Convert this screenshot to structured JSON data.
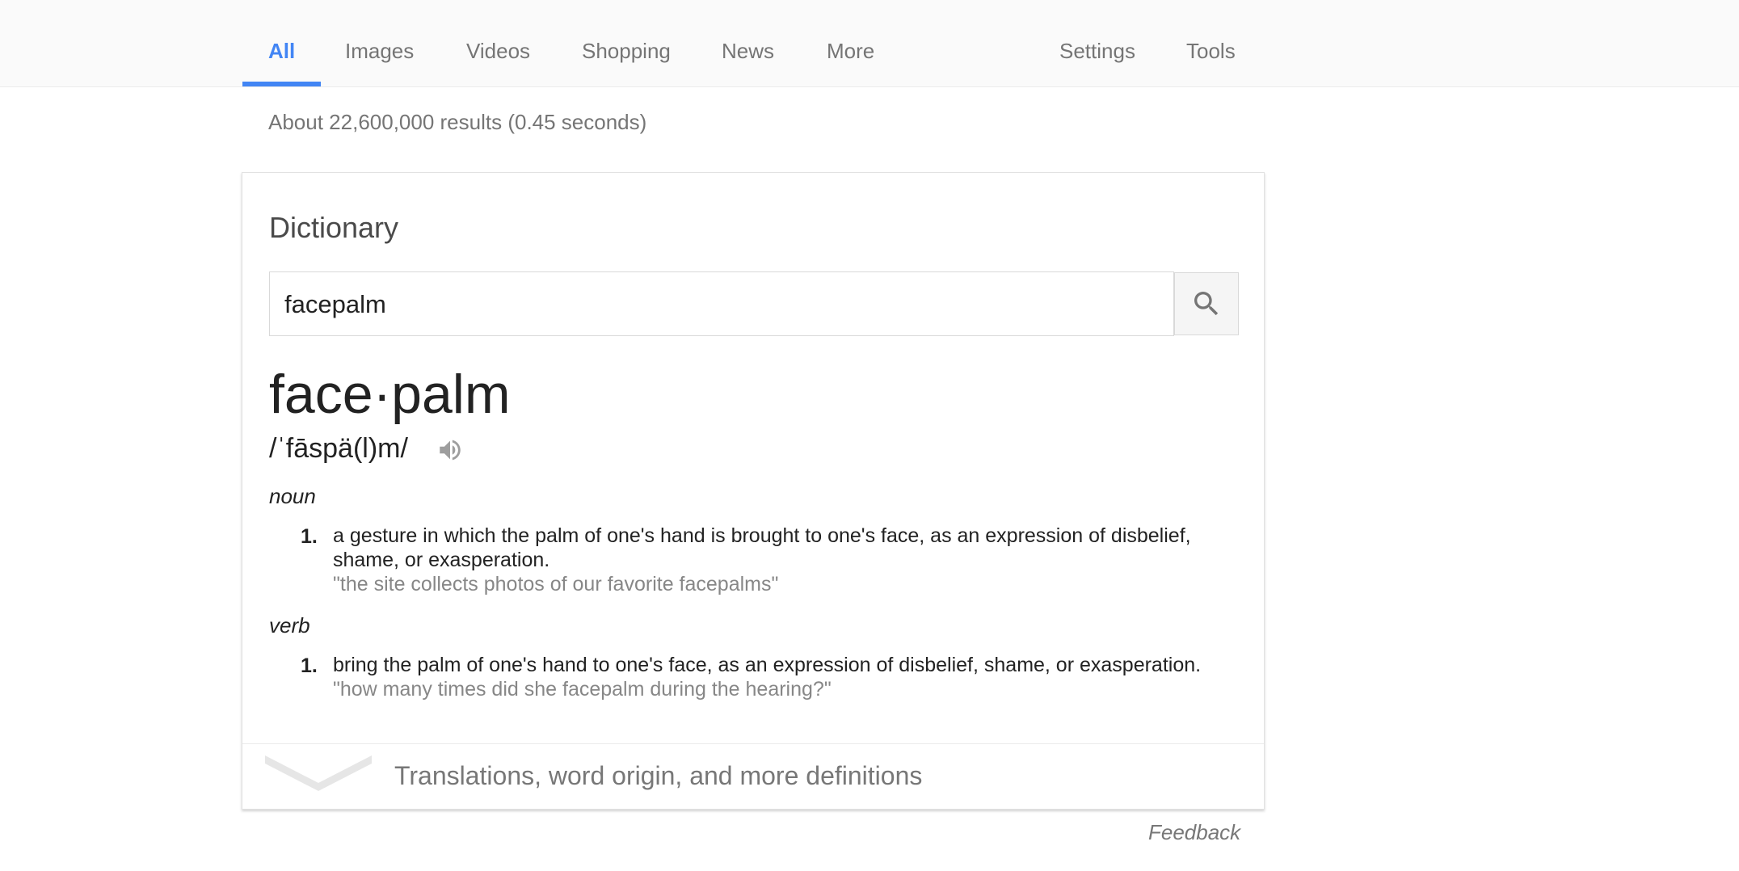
{
  "nav": {
    "tabs": [
      {
        "label": "All",
        "active": true
      },
      {
        "label": "Images"
      },
      {
        "label": "Videos"
      },
      {
        "label": "Shopping"
      },
      {
        "label": "News"
      },
      {
        "label": "More"
      }
    ],
    "settings_label": "Settings",
    "tools_label": "Tools",
    "accent_color": "#4285f4"
  },
  "results_stats": "About 22,600,000 results (0.45 seconds)",
  "dictionary": {
    "title": "Dictionary",
    "search": {
      "value": "facepalm",
      "button_icon": "search-icon"
    },
    "headword": "face·palm",
    "phonetic": "/ˈfāspä(l)m/",
    "speaker_icon": "speaker-icon",
    "entries": [
      {
        "pos": "noun",
        "definitions": [
          {
            "number": "1.",
            "text": "a gesture in which the palm of one's hand is brought to one's face, as an expression of disbelief, shame, or exasperation.",
            "example": "\"the site collects photos of our favorite facepalms\""
          }
        ]
      },
      {
        "pos": "verb",
        "definitions": [
          {
            "number": "1.",
            "text": "bring the palm of one's hand to one's face, as an expression of disbelief, shame, or exasperation.",
            "example": "\"how many times did she facepalm during the hearing?\""
          }
        ]
      }
    ],
    "more_label": "Translations, word origin, and more definitions",
    "more_icon": "chevron-down-icon"
  },
  "feedback_label": "Feedback"
}
